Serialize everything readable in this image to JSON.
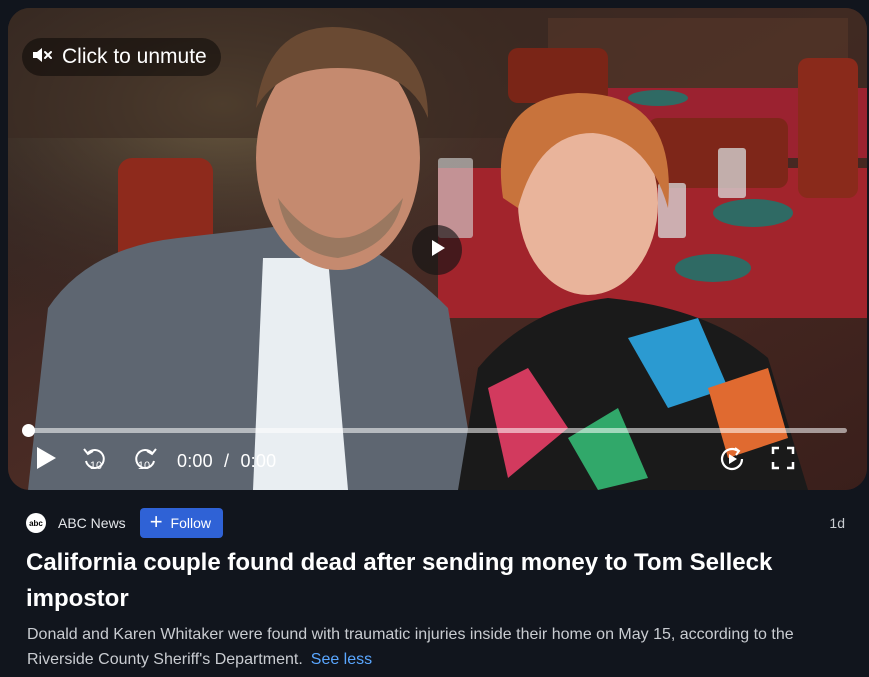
{
  "video": {
    "unmute_label": "Click to unmute",
    "progress": 0,
    "current_time": "0:00",
    "time_separator": "/",
    "duration": "0:00",
    "rewind_seconds": "10",
    "forward_seconds": "10",
    "icons": {
      "mute": "speaker-muted-icon",
      "center": "play-icon",
      "play": "play-icon",
      "rewind": "rewind-10-icon",
      "forward": "forward-10-icon",
      "autoplay": "autoplay-icon",
      "fullscreen": "fullscreen-icon"
    }
  },
  "article": {
    "source": "ABC News",
    "source_logo_text": "abc",
    "follow_label": "Follow",
    "age": "1d",
    "headline": "California couple found dead after sending money to Tom Selleck impostor",
    "summary": "Donald and Karen Whitaker were found with traumatic injuries inside their home on May 15, according to the Riverside County Sheriff's Department.",
    "see_less_label": "See less"
  },
  "colors": {
    "background": "#11151d",
    "follow_button": "#2f62d6",
    "link": "#5aa7ff"
  }
}
